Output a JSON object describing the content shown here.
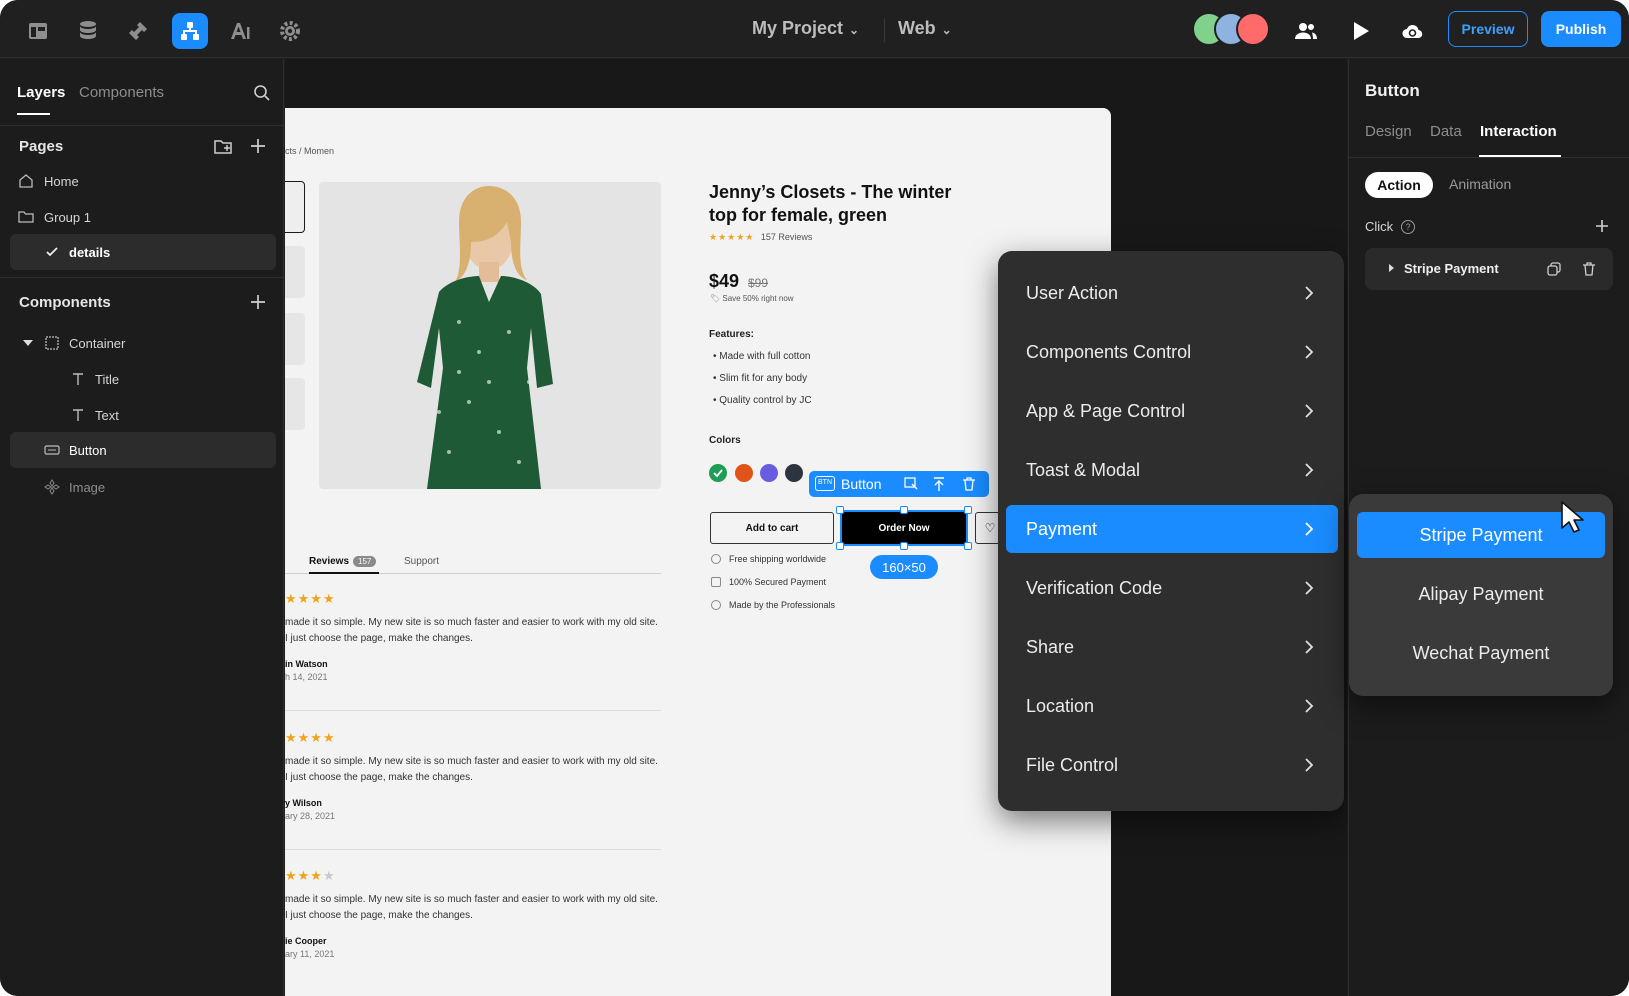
{
  "topbar": {
    "project_name": "My Project",
    "platform": "Web",
    "preview_label": "Preview",
    "publish_label": "Publish",
    "accent_color": "#1a8cff",
    "tools": [
      "pages-icon",
      "database-icon",
      "plugin-icon",
      "logic-icon",
      "ai-icon",
      "gear-icon"
    ],
    "active_tool": "logic-icon"
  },
  "left": {
    "tabs": [
      "Layers",
      "Components"
    ],
    "active_tab": "Layers",
    "pages_title": "Pages",
    "pages": [
      {
        "label": "Home",
        "icon": "home-icon"
      },
      {
        "label": "Group 1",
        "icon": "folder-icon"
      },
      {
        "label": "details",
        "icon": "check-icon",
        "selected": true
      }
    ],
    "components_title": "Components",
    "components": [
      {
        "label": "Container",
        "icon": "container-icon"
      },
      {
        "label": "Title",
        "icon": "text-icon"
      },
      {
        "label": "Text",
        "icon": "text-icon"
      },
      {
        "label": "Button",
        "icon": "button-icon",
        "selected": true
      },
      {
        "label": "Image",
        "icon": "image-icon"
      }
    ]
  },
  "product": {
    "breadcrumb": "cts / Momen",
    "title": "Jenny’s Closets - The winter top for female, green",
    "reviews_count": "157 Reviews",
    "rating": 5,
    "price": "$49",
    "old_price": "$99",
    "save_note": "Save 50% right now",
    "features_title": "Features:",
    "features": [
      "Made with full cotton",
      "Slim fit for any body",
      "Quality control by JC"
    ],
    "colors_title": "Colors",
    "colors": [
      "#1f9d55",
      "#e0541a",
      "#6a5ce0",
      "#2c3440"
    ],
    "selected_color_index": 0,
    "add_to_cart": "Add to cart",
    "order_now": "Order Now",
    "info": [
      "Free shipping worldwide",
      "100% Secured Payment",
      "Made by the Professionals"
    ],
    "tabs": {
      "reviews": "Reviews",
      "reviews_badge": "157",
      "support": "Support"
    }
  },
  "selection": {
    "label": "Button",
    "size": "160×50"
  },
  "reviews": [
    {
      "stars": 4,
      "text": "made it so simple. My new site is so much faster and easier to work with my old site. I just choose the page, make the changes.",
      "name": "in Watson",
      "date": "h 14, 2021"
    },
    {
      "stars": 4,
      "text": "made it so simple. My new site is so much faster and easier to work with my old site. I just choose the page, make the changes.",
      "name": "y Wilson",
      "date": "ary 28, 2021"
    },
    {
      "stars": 3,
      "empty": 1,
      "text": "made it so simple. My new site is so much faster and easier to work with my old site. I just choose the page, make the changes.",
      "name": "ie Cooper",
      "date": "ary 11, 2021"
    }
  ],
  "action_menu": {
    "items": [
      "User Action",
      "Components Control",
      "App & Page Control",
      "Toast & Modal",
      "Payment",
      "Verification Code",
      "Share",
      "Location",
      "File Control"
    ],
    "active": "Payment"
  },
  "submenu": {
    "items": [
      "Stripe Payment",
      "Alipay Payment",
      "Wechat Payment"
    ],
    "active": "Stripe Payment"
  },
  "right": {
    "title": "Button",
    "tabs": [
      "Design",
      "Data",
      "Interaction"
    ],
    "active_tab": "Interaction",
    "pill_active": "Action",
    "pill_other": "Animation",
    "event": "Click",
    "action": "Stripe Payment"
  }
}
